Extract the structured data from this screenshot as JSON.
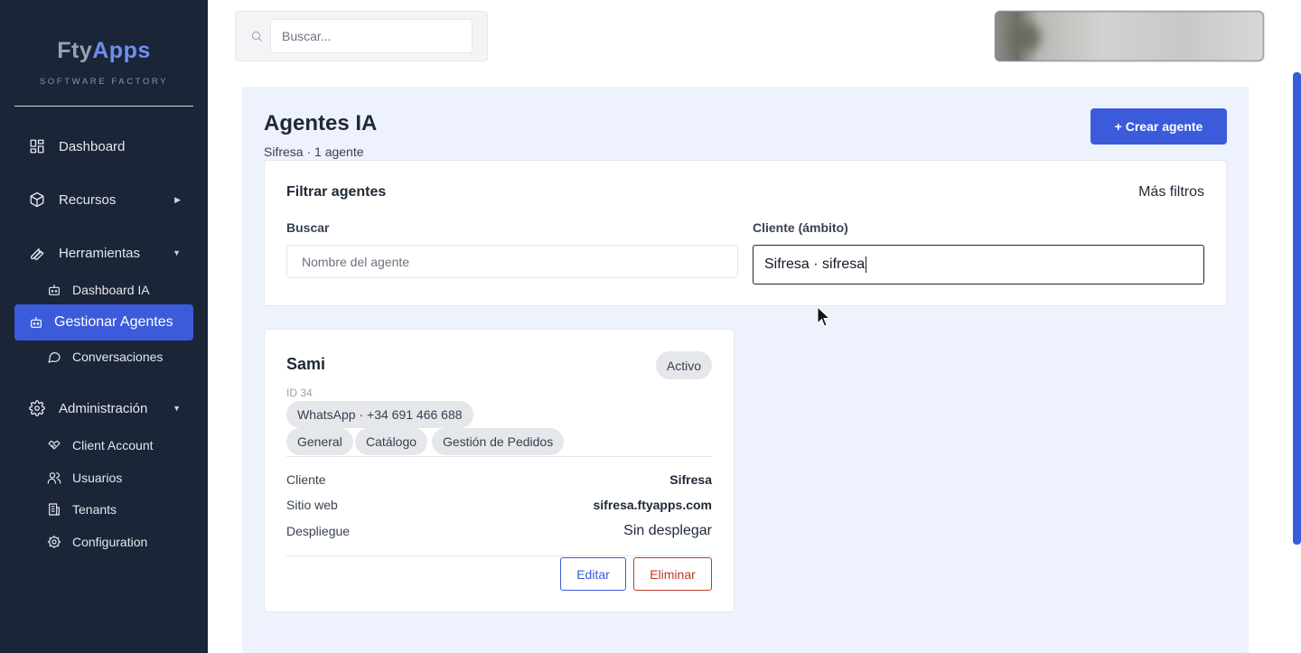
{
  "sidebar": {
    "logo": {
      "part1": "Fty",
      "part2": "Apps",
      "subtitle": "SOFTWARE FACTORY"
    },
    "items": {
      "dashboard": "Dashboard",
      "recursos": "Recursos",
      "herramientas": "Herramientas",
      "dashboard_ia": "Dashboard IA",
      "gestionar_agentes": "Gestionar Agentes",
      "conversaciones": "Conversaciones",
      "administracion": "Administración",
      "client_account": "Client Account",
      "usuarios": "Usuarios",
      "tenants": "Tenants",
      "configuration": "Configuration"
    },
    "carets": {
      "collapsed": "▶",
      "expanded": "▼"
    }
  },
  "topbar": {
    "search_placeholder": "Buscar..."
  },
  "page": {
    "title": "Agentes IA",
    "subtitle": "Sifresa · 1 agente",
    "create_button": "+ Crear agente"
  },
  "filters": {
    "title": "Filtrar agentes",
    "more": "Más filtros",
    "search_label": "Buscar",
    "search_placeholder": "Nombre del agente",
    "client_label": "Cliente (ámbito)",
    "client_value": "Sifresa · sifresa"
  },
  "agent": {
    "name": "Sami",
    "status": "Activo",
    "id": "ID 34",
    "channel": "WhatsApp · +34 691 466 688",
    "tags": [
      "General",
      "Catálogo",
      "Gestión de Pedidos"
    ],
    "details": {
      "cliente_label": "Cliente",
      "cliente_value": "Sifresa",
      "sitio_label": "Sitio web",
      "sitio_value": "sifresa.ftyapps.com",
      "despliegue_label": "Despliegue",
      "despliegue_value": "Sin desplegar"
    },
    "edit_button": "Editar",
    "delete_button": "Eliminar"
  },
  "colors": {
    "sidebar_bg": "#1b2538",
    "accent": "#3b5bdb",
    "danger": "#c0392b",
    "content_bg": "#eef2fd"
  }
}
